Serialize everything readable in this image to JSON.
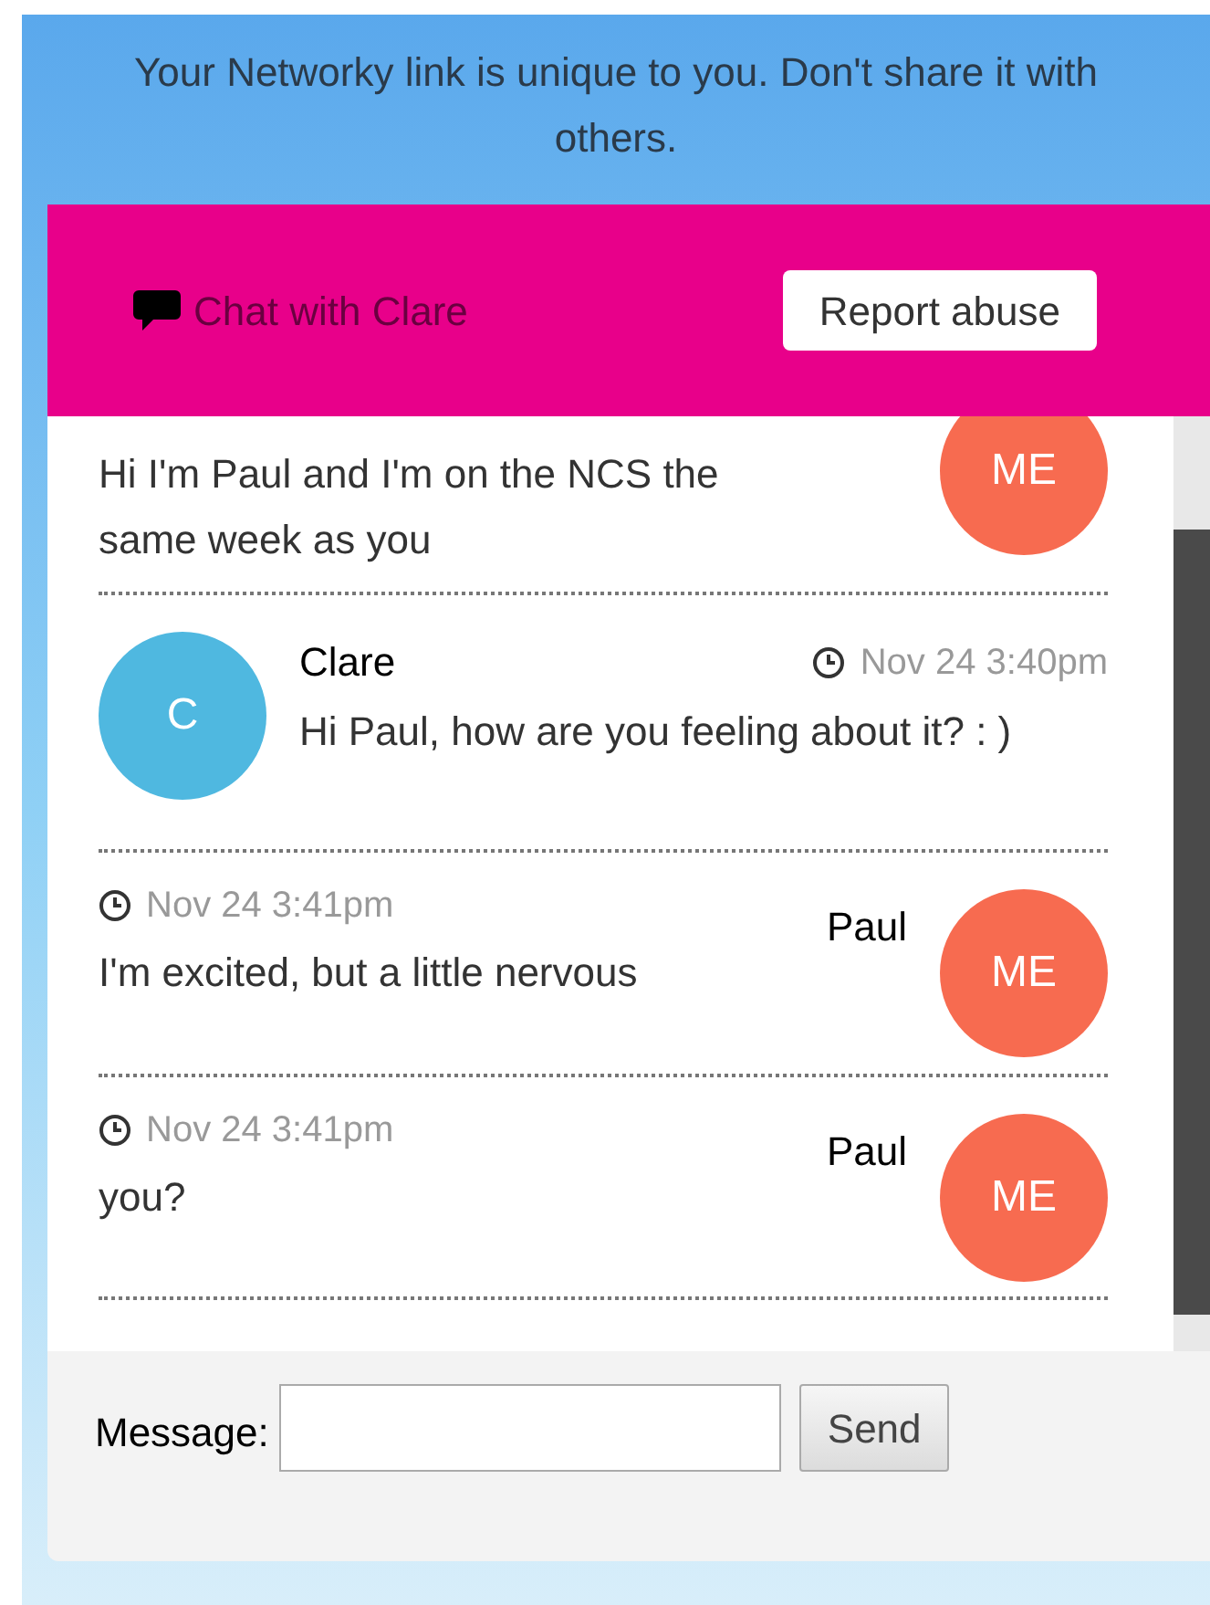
{
  "notice": "Your Networky link is unique to you. Don't share it with others.",
  "chat": {
    "title": "Chat with Clare",
    "report_button": "Report abuse"
  },
  "messages": [
    {
      "kind": "mine",
      "text": "Hi I'm Paul and I'm on the NCS the same week as you",
      "avatar": "ME"
    },
    {
      "kind": "theirs",
      "sender": "Clare",
      "time": "Nov 24 3:40pm",
      "text": "Hi Paul, how are you feeling about it? : )",
      "avatar": "C"
    },
    {
      "kind": "mine",
      "sender": "Paul",
      "time": "Nov 24 3:41pm",
      "text": "I'm excited, but a little nervous",
      "avatar": "ME"
    },
    {
      "kind": "mine",
      "sender": "Paul",
      "time": "Nov 24 3:41pm",
      "text": "you?",
      "avatar": "ME"
    }
  ],
  "composer": {
    "label": "Message:",
    "send_button": "Send"
  }
}
